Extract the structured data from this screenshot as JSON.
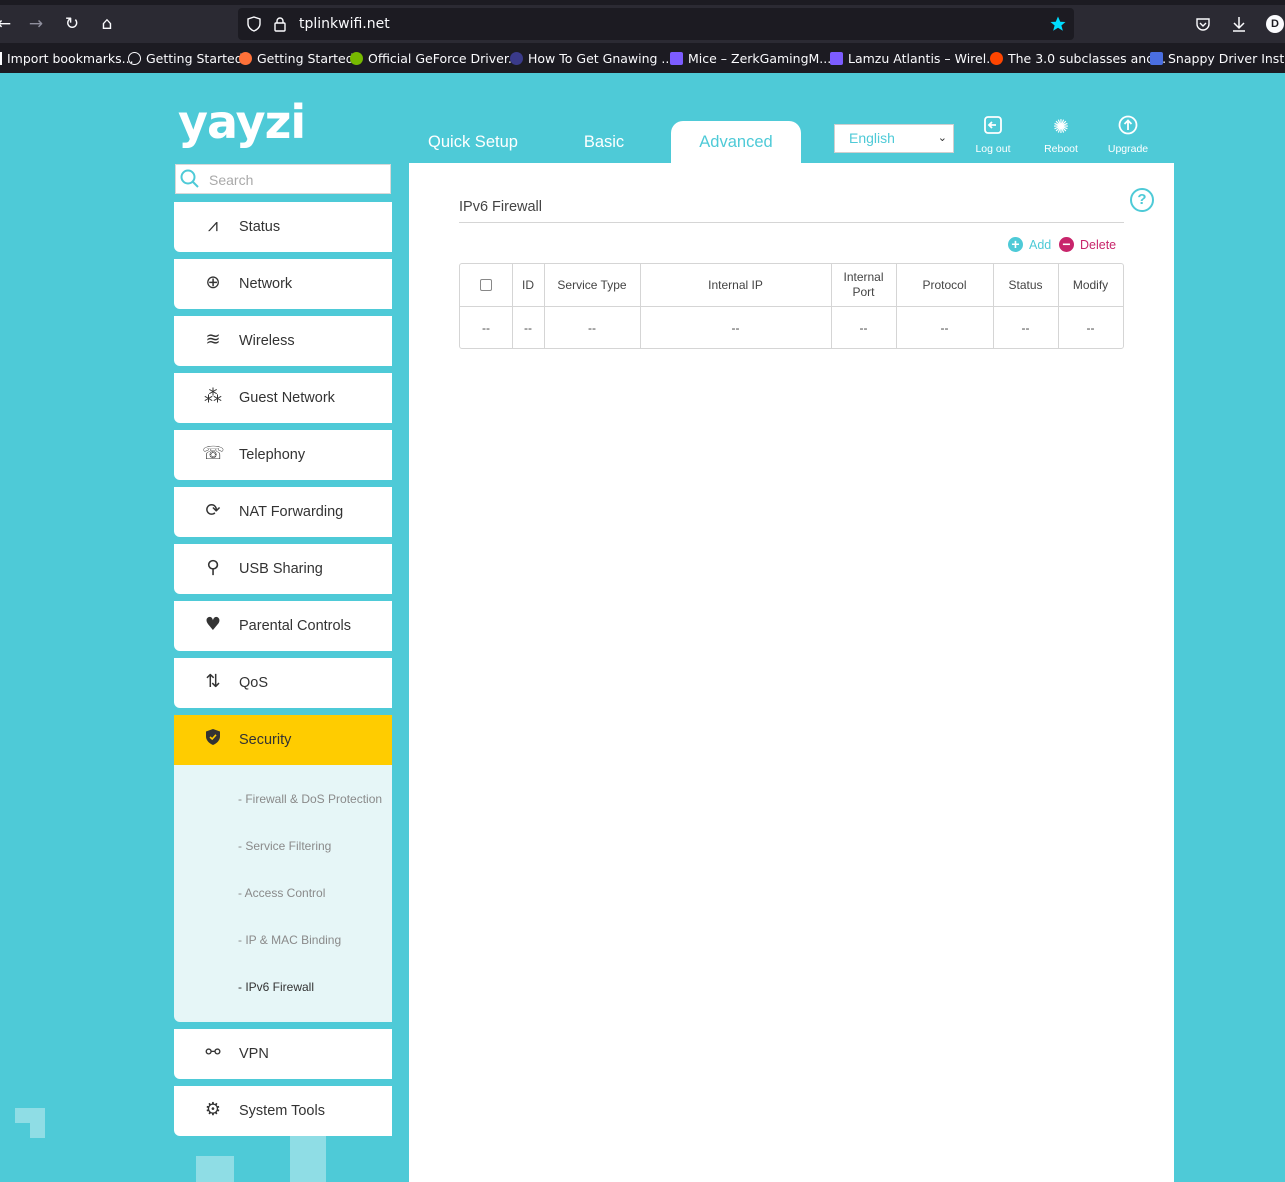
{
  "browser": {
    "url": "tplinkwifi.net",
    "bookmarks": [
      "Import bookmarks...",
      "Getting Started",
      "Getting Started",
      "Official GeForce Driver...",
      "How To Get Gnawing ...",
      "Mice – ZerkGamingM...",
      "Lamzu Atlantis – Wirel...",
      "The 3.0 subclasses and...",
      "Snappy Driver Installer"
    ],
    "avatar_letter": "D"
  },
  "router": {
    "logo": "yayzi",
    "tabs": [
      "Quick Setup",
      "Basic",
      "Advanced"
    ],
    "language": "English",
    "tools": [
      "Log out",
      "Reboot",
      "Upgrade"
    ],
    "search_placeholder": "Search",
    "menu": [
      {
        "label": "Status",
        "icon": "pulse-icon"
      },
      {
        "label": "Network",
        "icon": "globe-icon"
      },
      {
        "label": "Wireless",
        "icon": "wifi-icon"
      },
      {
        "label": "Guest Network",
        "icon": "guests-icon"
      },
      {
        "label": "Telephony",
        "icon": "phone-icon"
      },
      {
        "label": "NAT Forwarding",
        "icon": "nat-icon"
      },
      {
        "label": "USB Sharing",
        "icon": "usb-icon"
      },
      {
        "label": "Parental Controls",
        "icon": "heart-icon"
      },
      {
        "label": "QoS",
        "icon": "qos-arrows-icon"
      },
      {
        "label": "Security",
        "icon": "shield-icon"
      },
      {
        "label": "VPN",
        "icon": "link-icon"
      },
      {
        "label": "System Tools",
        "icon": "gear-icon"
      }
    ],
    "submenu": [
      "- Firewall & DoS Protection",
      "- Service Filtering",
      "- Access Control",
      "- IP & MAC Binding",
      "- IPv6 Firewall"
    ],
    "page_title": "IPv6 Firewall",
    "add_label": "Add",
    "delete_label": "Delete",
    "table": {
      "headers": [
        "",
        "ID",
        "Service Type",
        "Internal IP",
        "Internal Port",
        "Protocol",
        "Status",
        "Modify"
      ],
      "row": [
        "--",
        "--",
        "--",
        "--",
        "--",
        "--",
        "--",
        "--"
      ]
    },
    "colors": {
      "accent": "#4ecad7",
      "selected": "#ffcc00",
      "delete": "#c8256b"
    }
  }
}
